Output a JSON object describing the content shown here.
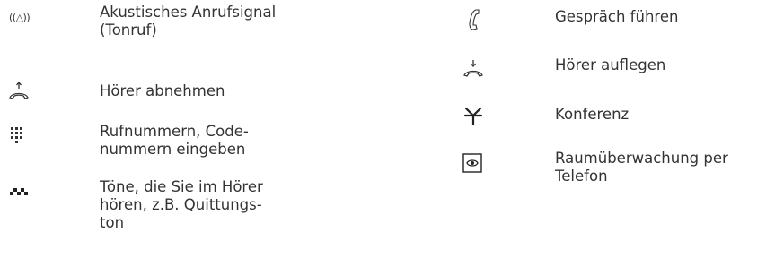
{
  "left_column": [
    {
      "icon": "acoustic-ring-signal-icon",
      "glyph": "((△))",
      "text": "Akustisches Anrufsignal\n(Tonruf)"
    },
    {
      "icon": "lift-handset-icon",
      "text": "Hörer abnehmen"
    },
    {
      "icon": "keypad-icon",
      "text": "Rufnummern, Code-\nnummern eingeben"
    },
    {
      "icon": "tones-icon",
      "text": "Töne, die Sie im Hörer\nhören, z.B. Quittungs-\nton"
    }
  ],
  "right_column": [
    {
      "icon": "handset-call-icon",
      "text": "Gespräch führen"
    },
    {
      "icon": "hang-up-handset-icon",
      "text": "Hörer auflegen"
    },
    {
      "icon": "conference-icon",
      "text": "Konferenz"
    },
    {
      "icon": "room-monitoring-icon",
      "text": "Raumüberwachung per\nTelefon"
    }
  ],
  "colors": {
    "text": "#333333",
    "background": "#ffffff"
  }
}
